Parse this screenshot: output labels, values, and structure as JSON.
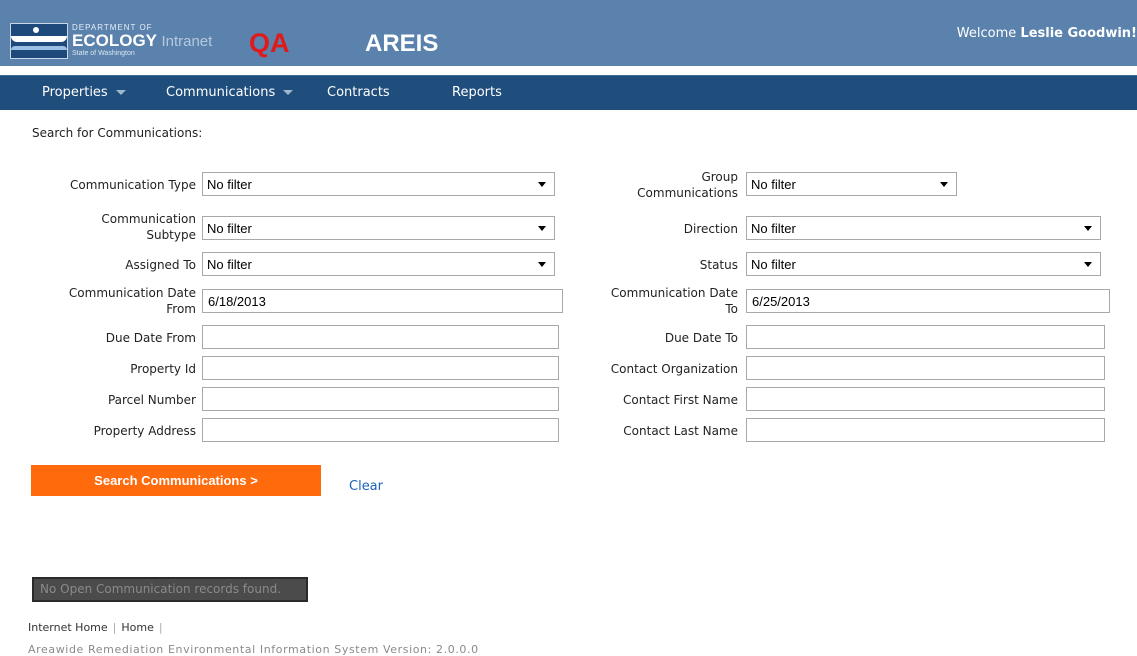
{
  "header": {
    "logo": {
      "department": "DEPARTMENT OF",
      "name": "ECOLOGY",
      "suffix": "Intranet",
      "state": "State of Washington"
    },
    "environment": "QA",
    "app_title": "AREIS",
    "welcome_prefix": "Welcome",
    "user_name": "Leslie Goodwin!"
  },
  "nav": {
    "items": [
      {
        "label": "Properties",
        "has_dropdown": true
      },
      {
        "label": "Communications",
        "has_dropdown": true
      },
      {
        "label": "Contracts",
        "has_dropdown": false
      },
      {
        "label": "Reports",
        "has_dropdown": false
      }
    ]
  },
  "form": {
    "heading": "Search for Communications:",
    "communication_type": {
      "label": "Communication Type",
      "value": "No filter"
    },
    "communication_subtype": {
      "label_line1": "Communication",
      "label_line2": "Subtype",
      "value": "No filter"
    },
    "assigned_to": {
      "label": "Assigned To",
      "value": "No filter"
    },
    "comm_date_from": {
      "label_line1": "Communication Date",
      "label_line2": "From",
      "value": "6/18/2013"
    },
    "due_date_from": {
      "label": "Due Date From",
      "value": ""
    },
    "property_id": {
      "label": "Property Id",
      "value": ""
    },
    "parcel_number": {
      "label": "Parcel Number",
      "value": ""
    },
    "property_address": {
      "label": "Property Address",
      "value": ""
    },
    "group_communications": {
      "label_line1": "Group",
      "label_line2": "Communications",
      "value": "No filter"
    },
    "direction": {
      "label": "Direction",
      "value": "No filter"
    },
    "status": {
      "label": "Status",
      "value": "No filter"
    },
    "comm_date_to": {
      "label_line1": "Communication Date",
      "label_line2": "To",
      "value": "6/25/2013"
    },
    "due_date_to": {
      "label": "Due Date To",
      "value": ""
    },
    "contact_organization": {
      "label": "Contact Organization",
      "value": ""
    },
    "contact_first_name": {
      "label": "Contact First Name",
      "value": ""
    },
    "contact_last_name": {
      "label": "Contact Last Name",
      "value": ""
    },
    "search_button": "Search Communications >",
    "clear_link": "Clear"
  },
  "results": {
    "message": "No Open Communication records found."
  },
  "footer": {
    "links": [
      "Internet Home",
      "Home"
    ],
    "version": "Areawide Remediation Environmental Information System Version: 2.0.0.0"
  },
  "colors": {
    "header_bg": "#5a82ad",
    "nav_bg": "#1f4d7c",
    "button_bg": "#ff6a0d",
    "env_label": "#e01a1a",
    "link": "#1a63b8"
  }
}
